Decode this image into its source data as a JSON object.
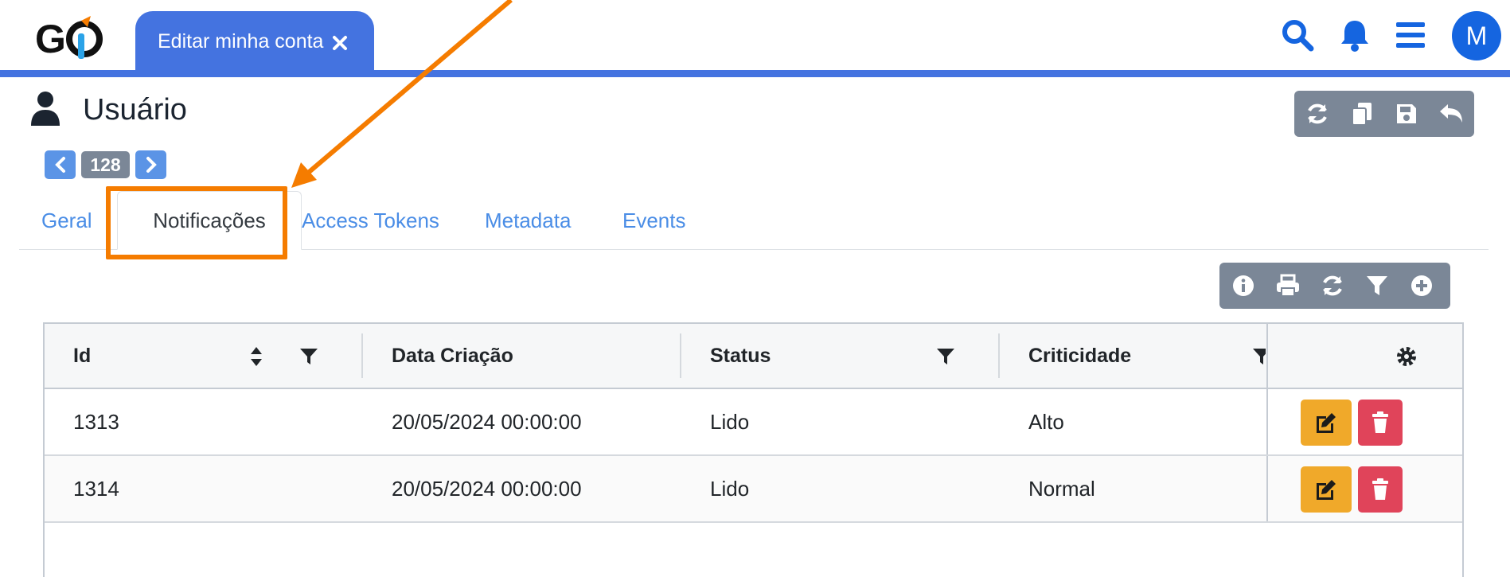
{
  "header": {
    "logo_text": "GO",
    "open_tab_label": "Editar minha conta",
    "icons": [
      "search-icon",
      "bell-icon",
      "menu-icon"
    ],
    "avatar_initial": "M"
  },
  "page": {
    "title": "Usuário",
    "record_number": "128",
    "toolbar_icons": [
      "refresh-icon",
      "copy-icon",
      "save-icon",
      "undo-icon"
    ]
  },
  "tabs": [
    {
      "label": "Geral",
      "active": false
    },
    {
      "label": "Notificações",
      "active": true
    },
    {
      "label": "Access Tokens",
      "active": false
    },
    {
      "label": "Metadata",
      "active": false
    },
    {
      "label": "Events",
      "active": false
    }
  ],
  "grid_toolbar_icons": [
    "info-icon",
    "print-icon",
    "refresh-icon",
    "filter-icon",
    "add-icon"
  ],
  "table": {
    "columns": [
      "Id",
      "Data Criação",
      "Status",
      "Criticidade"
    ],
    "actions_icon": "gear-icon",
    "rows": [
      {
        "id": "1313",
        "data_criacao": "20/05/2024 00:00:00",
        "status": "Lido",
        "criticidade": "Alto"
      },
      {
        "id": "1314",
        "data_criacao": "20/05/2024 00:00:00",
        "status": "Lido",
        "criticidade": "Normal"
      }
    ]
  },
  "colors": {
    "brand_blue": "#4473e0",
    "annotation_orange": "#f57c00",
    "edit_yellow": "#f0a92a",
    "delete_red": "#e0445a",
    "button_grey": "#7b8797"
  }
}
